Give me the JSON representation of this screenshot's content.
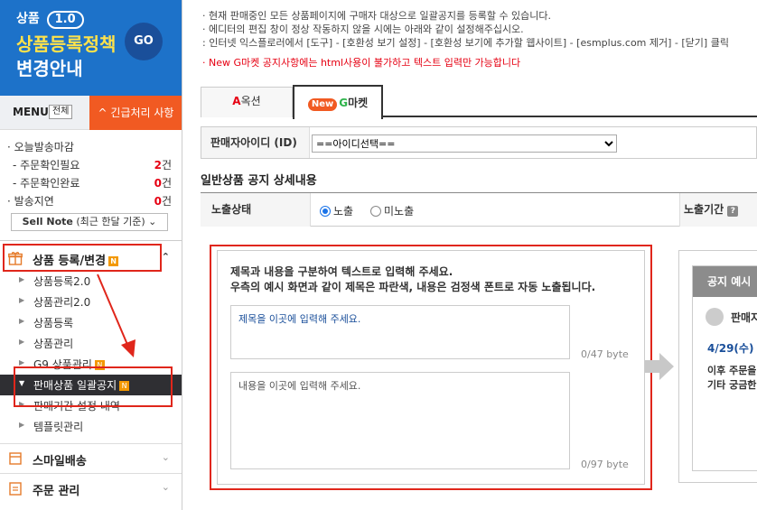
{
  "banner": {
    "small": "상품",
    "version": "1.0",
    "title1": "상품등록정책",
    "title2": "변경안내",
    "go": "GO"
  },
  "menu": {
    "label": "MENU",
    "all": "전체",
    "urgent": "^ 긴급처리 사항"
  },
  "stats": [
    {
      "label": "· 오늘발송마감",
      "value": "",
      "unit": "",
      "sub": false
    },
    {
      "label": "- 주문확인필요",
      "value": "2",
      "unit": "건",
      "sub": true
    },
    {
      "label": "- 주문확인완료",
      "value": "0",
      "unit": "건",
      "sub": true
    },
    {
      "label": "· 발송지연",
      "value": "0",
      "unit": "건",
      "sub": false
    }
  ],
  "sellnote": {
    "bold": "Sell Note",
    "rest": " (최근 한달 기준) ⌄"
  },
  "sidebar": {
    "product_reg": {
      "label": "상품 등록/변경",
      "badge": "N",
      "chevron": "⌃"
    },
    "items": [
      {
        "label": "상품등록2.0"
      },
      {
        "label": "상품관리2.0"
      },
      {
        "label": "상품등록"
      },
      {
        "label": "상품관리"
      },
      {
        "label": "G9 상품관리",
        "badge": "N"
      },
      {
        "label": "판매상품 일괄공지",
        "badge": "N",
        "active": true
      },
      {
        "label": "판매기간 설정 내역"
      },
      {
        "label": "템플릿관리"
      }
    ],
    "smile": {
      "label": "스마일배송"
    },
    "order": {
      "label": "주문 관리"
    }
  },
  "notes": {
    "line1": "· 현재 판매중인 모든 상품페이지에 구매자 대상으로 일괄공지를 등록할 수 있습니다.",
    "line2": "· 에디터의 편집 창이 정상 작동하지 않을 시에는 아래와 같이 설정해주십시오.",
    "line3": ": 인터넷 익스플로러에서 [도구] - [호환성 보기 설정] - [호환성 보기에 추가할 웹사이트] - [esmplus.com 제거] - [닫기] 클릭",
    "red": "· New G마켓 공지사항에는 html사용이 불가하고 텍스트 입력만 가능합니다"
  },
  "tabs": {
    "auction_a": "A",
    "auction_rest": "옥션",
    "new": "New",
    "gmarket_g": "G",
    "gmarket_rest": "마켓"
  },
  "seller": {
    "label": "판매자아이디 (ID)",
    "select": "==아이디선택=="
  },
  "section_title": "일반상품 공지 상세내용",
  "exposure": {
    "label": "노출상태",
    "on": "노출",
    "off": "미노출",
    "period": "노출기간",
    "q": "?"
  },
  "editor": {
    "hint1": "제목과 내용을 구분하여 텍스트로 입력해 주세요.",
    "hint2": "우측의 예시 화면과 같이 제목은 파란색, 내용은 검정색 폰트로 자동 노출됩니다.",
    "title_placeholder": "제목을 이곳에 입력해 주세요.",
    "title_count": "0/47 byte",
    "body_placeholder": "내용을 이곳에 입력해 주세요.",
    "body_count": "0/97 byte"
  },
  "preview": {
    "head": "공지 예시",
    "line1": "판매자",
    "line2": "4/29(수) .",
    "line3": "이후 주문을",
    "line4": "기타 궁금한"
  },
  "colors": {
    "brand_blue": "#1d72c9",
    "urgent_orange": "#f15a22",
    "highlight_red": "#e0261b",
    "gmarket_green": "#2db34a"
  }
}
